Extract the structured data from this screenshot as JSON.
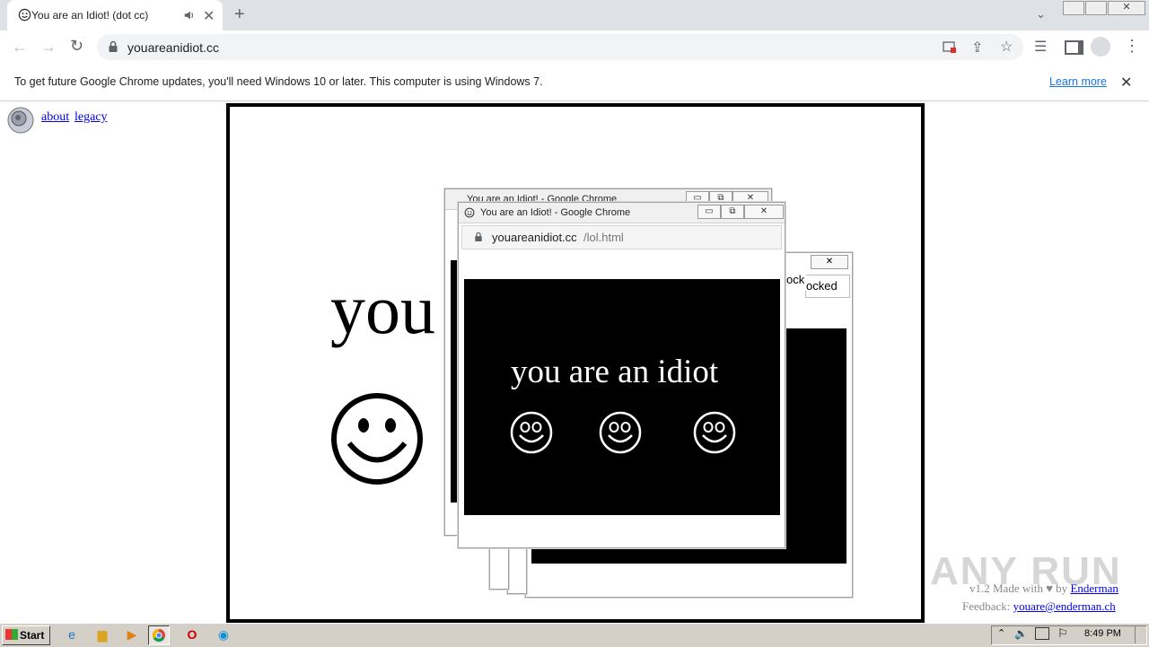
{
  "browser": {
    "tab_title": "You are an Idiot! (dot cc)",
    "url": "youareanidiot.cc",
    "infobar_text": "To get future Google Chrome updates, you'll need Windows 10 or later. This computer is using Windows 7.",
    "learn_more": "Learn more"
  },
  "page": {
    "links": [
      "about",
      "legacy"
    ],
    "big_text": "you",
    "made_with_prefix": "v1.2 Made with ♥ by",
    "author": "Enderman",
    "feedback_label": "Feedback:",
    "feedback_email": "youare@enderman.ch"
  },
  "popups": {
    "back_title": "You are an Idiot! - Google Chrome",
    "front_title": "You are an Idiot! - Google Chrome",
    "front_url_host": "youareanidiot.cc",
    "front_url_path": "/lol.html",
    "idiot_text": "you are an idiot",
    "side_fragment_1": "ock",
    "side_fragment_2": "ocked"
  },
  "watermark": "ANY RUN",
  "taskbar": {
    "start_label": "Start",
    "clock": "8:49 PM"
  }
}
